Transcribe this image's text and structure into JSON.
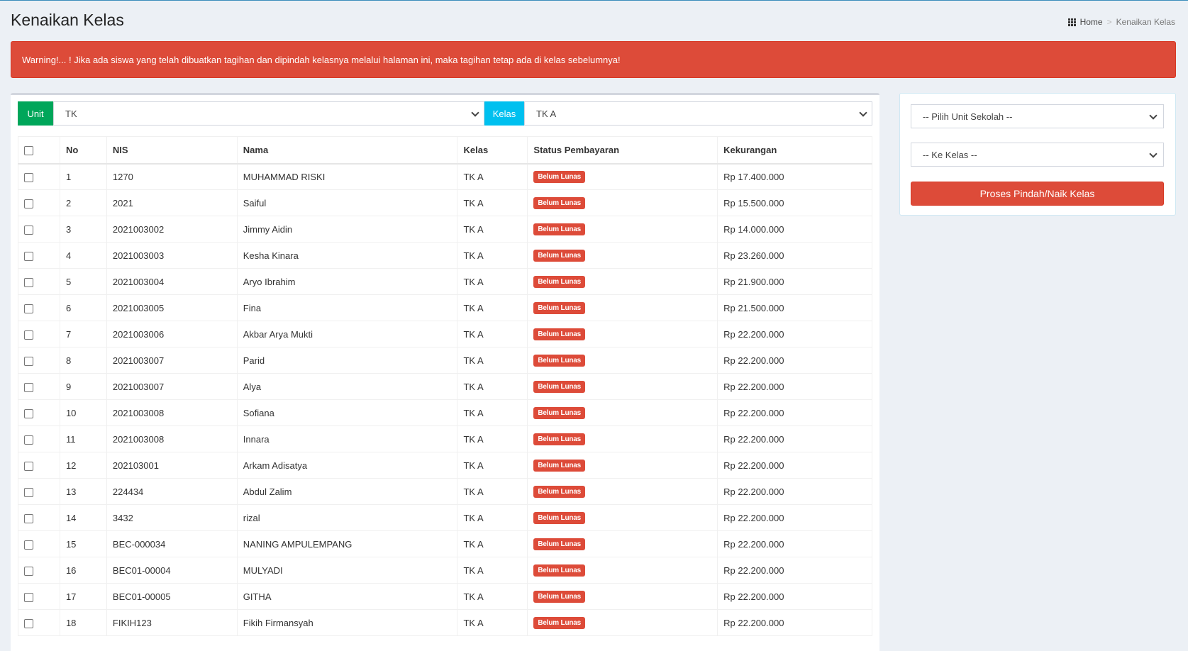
{
  "page": {
    "title": "Kenaikan Kelas",
    "breadcrumb": {
      "home": "Home",
      "current": "Kenaikan Kelas"
    }
  },
  "alert": {
    "text": "Warning!... ! Jika ada siswa yang telah dibuatkan tagihan dan dipindah kelasnya melalui halaman ini, maka tagihan tetap ada di kelas sebelumnya!"
  },
  "filters": {
    "unit_label": "Unit",
    "unit_value": "TK",
    "kelas_label": "Kelas",
    "kelas_value": "TK A"
  },
  "table": {
    "headers": {
      "no": "No",
      "nis": "NIS",
      "nama": "Nama",
      "kelas": "Kelas",
      "status": "Status Pembayaran",
      "kekurangan": "Kekurangan"
    },
    "rows": [
      {
        "no": "1",
        "nis": "1270",
        "nama": "MUHAMMAD RISKI",
        "kelas": "TK A",
        "status": "Belum Lunas",
        "kekurangan": "Rp 17.400.000"
      },
      {
        "no": "2",
        "nis": "2021",
        "nama": "Saiful",
        "kelas": "TK A",
        "status": "Belum Lunas",
        "kekurangan": "Rp 15.500.000"
      },
      {
        "no": "3",
        "nis": "2021003002",
        "nama": "Jimmy Aidin",
        "kelas": "TK A",
        "status": "Belum Lunas",
        "kekurangan": "Rp 14.000.000"
      },
      {
        "no": "4",
        "nis": "2021003003",
        "nama": "Kesha Kinara",
        "kelas": "TK A",
        "status": "Belum Lunas",
        "kekurangan": "Rp 23.260.000"
      },
      {
        "no": "5",
        "nis": "2021003004",
        "nama": "Aryo Ibrahim",
        "kelas": "TK A",
        "status": "Belum Lunas",
        "kekurangan": "Rp 21.900.000"
      },
      {
        "no": "6",
        "nis": "2021003005",
        "nama": "Fina",
        "kelas": "TK A",
        "status": "Belum Lunas",
        "kekurangan": "Rp 21.500.000"
      },
      {
        "no": "7",
        "nis": "2021003006",
        "nama": "Akbar Arya Mukti",
        "kelas": "TK A",
        "status": "Belum Lunas",
        "kekurangan": "Rp 22.200.000"
      },
      {
        "no": "8",
        "nis": "2021003007",
        "nama": "Parid",
        "kelas": "TK A",
        "status": "Belum Lunas",
        "kekurangan": "Rp 22.200.000"
      },
      {
        "no": "9",
        "nis": "2021003007",
        "nama": "Alya",
        "kelas": "TK A",
        "status": "Belum Lunas",
        "kekurangan": "Rp 22.200.000"
      },
      {
        "no": "10",
        "nis": "2021003008",
        "nama": "Sofiana",
        "kelas": "TK A",
        "status": "Belum Lunas",
        "kekurangan": "Rp 22.200.000"
      },
      {
        "no": "11",
        "nis": "2021003008",
        "nama": "Innara",
        "kelas": "TK A",
        "status": "Belum Lunas",
        "kekurangan": "Rp 22.200.000"
      },
      {
        "no": "12",
        "nis": "202103001",
        "nama": "Arkam Adisatya",
        "kelas": "TK A",
        "status": "Belum Lunas",
        "kekurangan": "Rp 22.200.000"
      },
      {
        "no": "13",
        "nis": "224434",
        "nama": "Abdul Zalim",
        "kelas": "TK A",
        "status": "Belum Lunas",
        "kekurangan": "Rp 22.200.000"
      },
      {
        "no": "14",
        "nis": "3432",
        "nama": "rizal",
        "kelas": "TK A",
        "status": "Belum Lunas",
        "kekurangan": "Rp 22.200.000"
      },
      {
        "no": "15",
        "nis": "BEC-000034",
        "nama": "NANING AMPULEMPANG",
        "kelas": "TK A",
        "status": "Belum Lunas",
        "kekurangan": "Rp 22.200.000"
      },
      {
        "no": "16",
        "nis": "BEC01-00004",
        "nama": "MULYADI",
        "kelas": "TK A",
        "status": "Belum Lunas",
        "kekurangan": "Rp 22.200.000"
      },
      {
        "no": "17",
        "nis": "BEC01-00005",
        "nama": "GITHA",
        "kelas": "TK A",
        "status": "Belum Lunas",
        "kekurangan": "Rp 22.200.000"
      },
      {
        "no": "18",
        "nis": "FIKIH123",
        "nama": "Fikih Firmansyah",
        "kelas": "TK A",
        "status": "Belum Lunas",
        "kekurangan": "Rp 22.200.000"
      }
    ]
  },
  "side": {
    "unit_select": "-- Pilih Unit Sekolah --",
    "kelas_select": "-- Ke Kelas --",
    "submit_label": "Proses Pindah/Naik Kelas"
  },
  "colors": {
    "danger": "#dd4b39",
    "success": "#00a65a",
    "info": "#00c0ef"
  }
}
